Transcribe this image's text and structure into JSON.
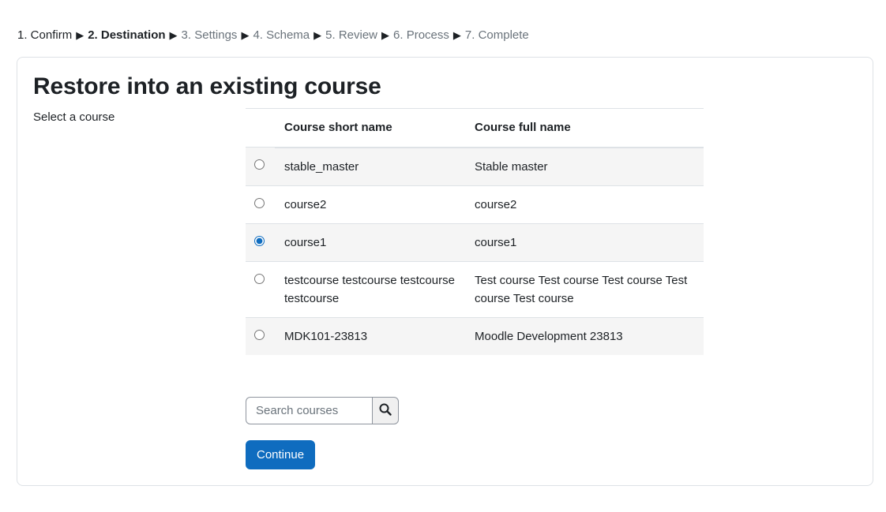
{
  "steps": [
    {
      "label": "1. Confirm",
      "state": "done"
    },
    {
      "label": "2. Destination",
      "state": "current"
    },
    {
      "label": "3. Settings",
      "state": "todo"
    },
    {
      "label": "4. Schema",
      "state": "todo"
    },
    {
      "label": "5. Review",
      "state": "todo"
    },
    {
      "label": "6. Process",
      "state": "todo"
    },
    {
      "label": "7. Complete",
      "state": "todo"
    }
  ],
  "step_separator": "▶",
  "card": {
    "title": "Restore into an existing course",
    "field_label": "Select a course"
  },
  "table": {
    "headers": {
      "short_name": "Course short name",
      "full_name": "Course full name"
    },
    "rows": [
      {
        "short_name": "stable_master",
        "full_name": "Stable master",
        "selected": false
      },
      {
        "short_name": "course2",
        "full_name": "course2",
        "selected": false
      },
      {
        "short_name": "course1",
        "full_name": "course1",
        "selected": true
      },
      {
        "short_name": "testcourse testcourse testcourse testcourse",
        "full_name": "Test course Test course Test course Test course Test course",
        "selected": false
      },
      {
        "short_name": "MDK101-23813",
        "full_name": "Moodle Development 23813",
        "selected": false
      }
    ]
  },
  "search": {
    "placeholder": "Search courses",
    "value": "",
    "icon": "search-icon"
  },
  "continue_label": "Continue",
  "colors": {
    "primary": "#0f6cbf",
    "muted": "#6a737b",
    "stripe": "#f5f5f5",
    "border": "#dee2e6"
  }
}
